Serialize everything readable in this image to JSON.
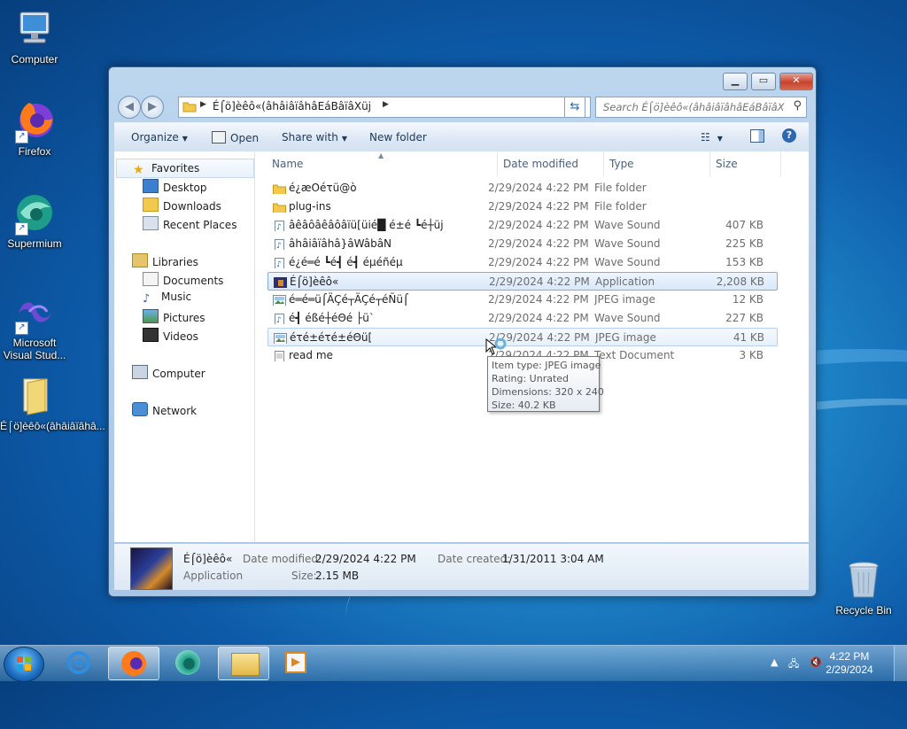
{
  "desktop": {
    "icons": [
      {
        "label": "Computer"
      },
      {
        "label": "Firefox"
      },
      {
        "label": "Supermium"
      },
      {
        "label": "Microsoft Visual Stud..."
      },
      {
        "label": "É⌠ö]èêô«(âhâiâïâhâ..."
      },
      {
        "label": "Recycle Bin"
      }
    ]
  },
  "window": {
    "address": {
      "segment": "É⌠ö]èêô«(âhâiâïâhâEáBâïâXüj"
    },
    "search": {
      "placeholder": "Search É⌠ö]èêô«(âhâiâïâhâEáBâïâXüj"
    },
    "toolbar": {
      "organize": "Organize",
      "open": "Open",
      "share_with": "Share with",
      "new_folder": "New folder"
    },
    "nav": {
      "favorites": "Favorites",
      "desktop": "Desktop",
      "downloads": "Downloads",
      "recent_places": "Recent Places",
      "libraries": "Libraries",
      "documents": "Documents",
      "music": "Music",
      "pictures": "Pictures",
      "videos": "Videos",
      "computer": "Computer",
      "network": "Network"
    },
    "columns": {
      "name": "Name",
      "date": "Date modified",
      "type": "Type",
      "size": "Size"
    },
    "files": [
      {
        "name": "é¿æOéτü@ò",
        "date": "2/29/2024 4:22 PM",
        "type": "File folder",
        "size": "",
        "icon": "folder-icon"
      },
      {
        "name": "plug-ins",
        "date": "2/29/2024 4:22 PM",
        "type": "File folder",
        "size": "",
        "icon": "folder-icon"
      },
      {
        "name": "âêâôâêâôâïü[üié█ é±é ┗é┼üj",
        "date": "2/29/2024 4:22 PM",
        "type": "Wave Sound",
        "size": "407 KB",
        "icon": "audio-file-icon"
      },
      {
        "name": "âhâiâïâhâ}âWâbâN",
        "date": "2/29/2024 4:22 PM",
        "type": "Wave Sound",
        "size": "225 KB",
        "icon": "audio-file-icon"
      },
      {
        "name": "é¿é═é ┗é┫ é┫ éµéñéµ",
        "date": "2/29/2024 4:22 PM",
        "type": "Wave Sound",
        "size": "153 KB",
        "icon": "audio-file-icon"
      },
      {
        "name": "É⌠ö]èêô«",
        "date": "2/29/2024 4:22 PM",
        "type": "Application",
        "size": "2,208 KB",
        "icon": "application-icon"
      },
      {
        "name": "é═é═ü⌠ÄÇé┬ÄÇé┬éÑü⌠",
        "date": "2/29/2024 4:22 PM",
        "type": "JPEG image",
        "size": "12 KB",
        "icon": "image-file-icon"
      },
      {
        "name": "é┫ éßé┼éΘé ├ü`",
        "date": "2/29/2024 4:22 PM",
        "type": "Wave Sound",
        "size": "227 KB",
        "icon": "audio-file-icon"
      },
      {
        "name": "éτé±éτé±éΘü[",
        "date": "2/29/2024 4:22 PM",
        "type": "JPEG image",
        "size": "41 KB",
        "icon": "image-file-icon"
      },
      {
        "name": "read me",
        "date": "2/29/2024 4:22 PM",
        "type": "Text Document",
        "size": "3 KB",
        "icon": "text-file-icon"
      }
    ],
    "tooltip": {
      "line1": "Item type: JPEG image",
      "line2": "Rating: Unrated",
      "line3": "Dimensions: 320 x 240",
      "line4": "Size: 40.2 KB"
    },
    "details": {
      "name": "É⌠ö]èêô«",
      "type": "Application",
      "modified_label": "Date modified:",
      "modified_value": "2/29/2024 4:22 PM",
      "created_label": "Date created:",
      "created_value": "1/31/2011 3:04 AM",
      "size_label": "Size:",
      "size_value": "2.15 MB"
    }
  },
  "taskbar": {
    "time": "4:22 PM",
    "date": "2/29/2024"
  },
  "colors": {
    "selection": "#d9e8fa",
    "accent": "#2b69b6"
  }
}
